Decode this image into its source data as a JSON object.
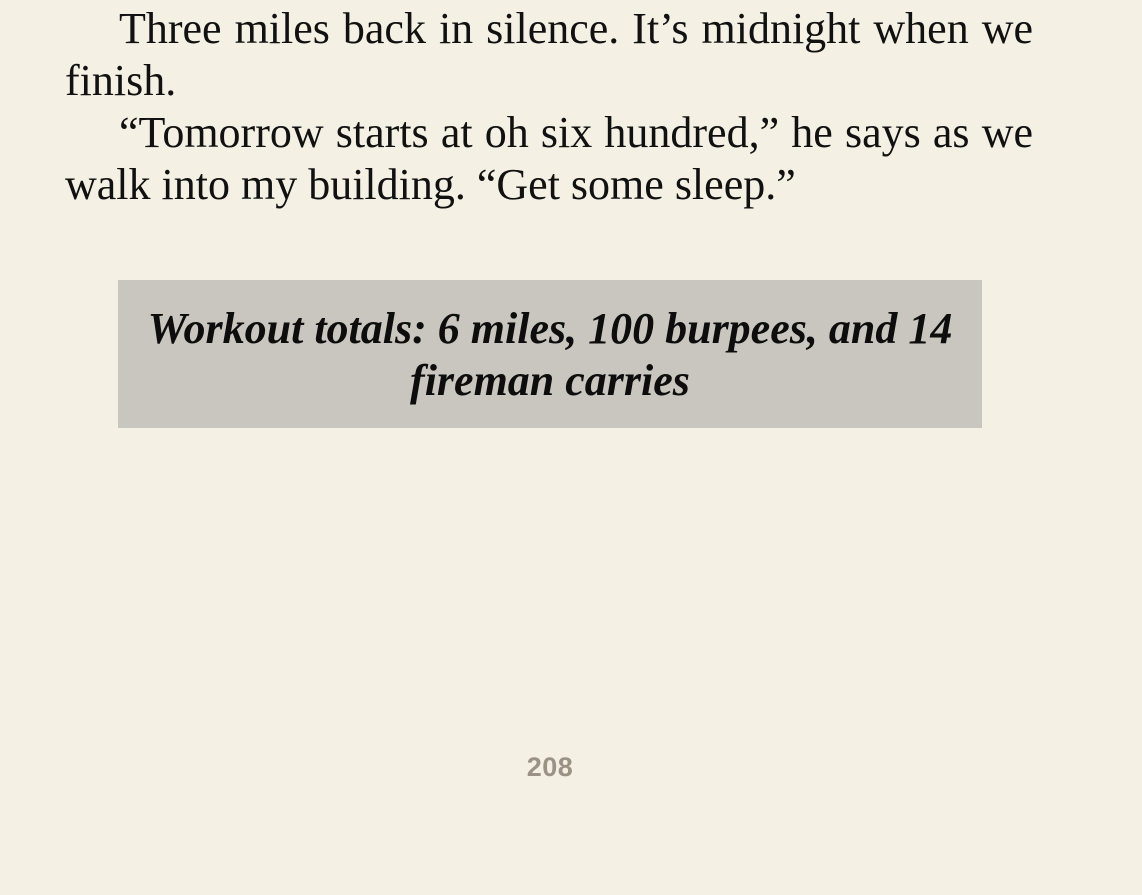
{
  "book": {
    "paragraphs": [
      "Three miles back in silence. It’s midnight when we finish.",
      "“Tomorrow starts at oh six hundred,” he says as we walk into my building. “Get some sleep.”"
    ],
    "callout": "Workout totals: 6 miles, 100 burpees, and 14 fireman carries",
    "page_number": "208"
  },
  "colors": {
    "background": "#f4f0e4",
    "callout_background": "#c8c6be",
    "text": "#111111",
    "page_number": "#9a9284"
  }
}
